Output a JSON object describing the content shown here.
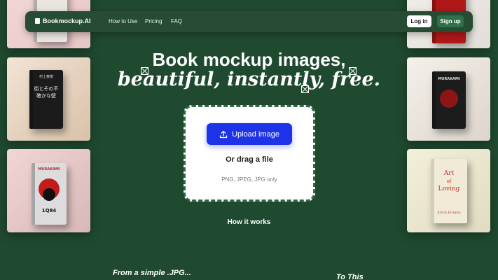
{
  "nav": {
    "brand": "Bookmockup.AI",
    "links": [
      "How to Use",
      "Pricing",
      "FAQ"
    ],
    "login": "Log in",
    "signup": "Sign up"
  },
  "hero": {
    "line1": "Book mockup images,",
    "line2": "beautiful, instantly, free."
  },
  "upload": {
    "button": "Upload image",
    "drag": "Or drag a file",
    "formats": "PNG, JPEG, JPG only"
  },
  "how_it_works": "How it works",
  "from_text": "From a simple .JPG...",
  "to_text": "To This",
  "books": {
    "murakami": "MURAKAMI",
    "q84": "1Q84",
    "art": "Art",
    "of": "of",
    "loving": "Loving",
    "fromm": "Erich Fromm",
    "jp_title": "街とその不確かな壁",
    "jp_author": "村上春樹"
  },
  "colors": {
    "background": "#1f4a2f",
    "accent_button": "#1e33e8",
    "signup_button": "#2e7048"
  }
}
